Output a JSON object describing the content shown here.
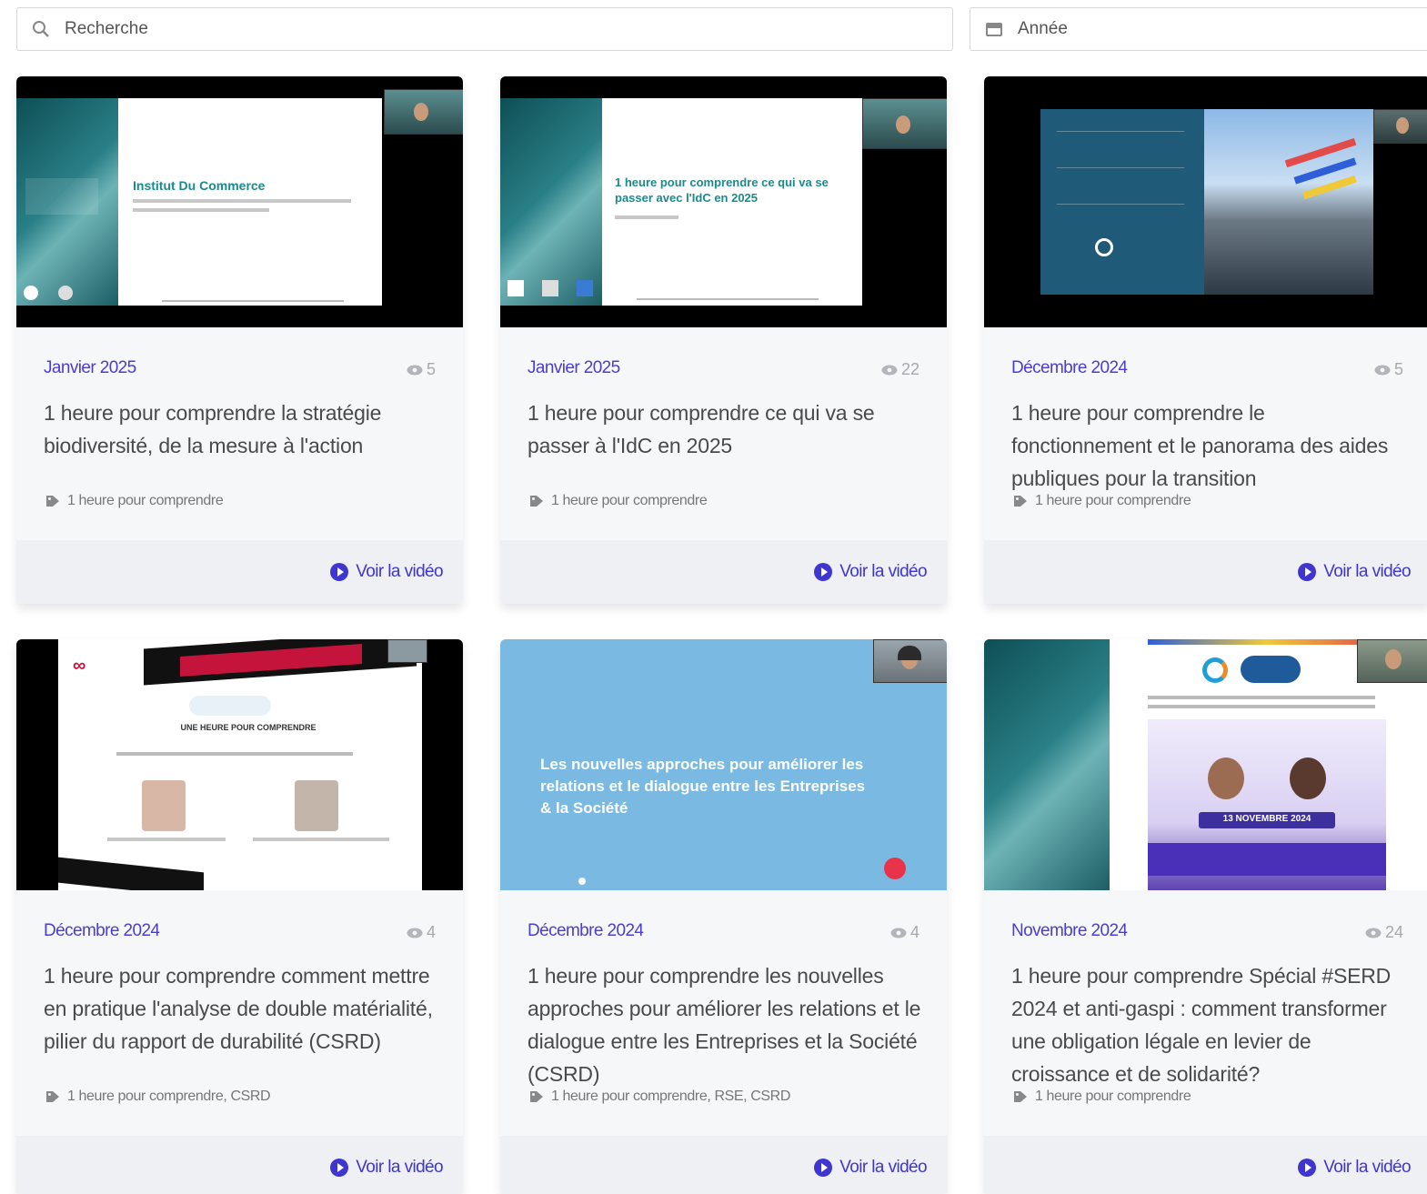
{
  "filters": {
    "search_placeholder": "Recherche",
    "year_placeholder": "Année"
  },
  "colors": {
    "accent": "#3f36d0",
    "card_bg": "#f6f7f9",
    "footer_bg": "#eef0f3"
  },
  "watch_label": "Voir la vidéo",
  "cards": [
    {
      "date": "Janvier 2025",
      "views": "5",
      "title": "1 heure pour comprendre la stratégie biodiversité, de la mesure à l'action",
      "tags": "1 heure pour comprendre",
      "slide": {
        "heading": "Institut Du Commerce"
      }
    },
    {
      "date": "Janvier 2025",
      "views": "22",
      "title": "1 heure pour comprendre ce qui va se passer à l'IdC en 2025",
      "tags": "1 heure pour comprendre",
      "slide": {
        "heading": "1 heure pour comprendre ce qui va se passer avec l'IdC en 2025"
      }
    },
    {
      "date": "Décembre 2024",
      "views": "5",
      "title": "1 heure pour comprendre le fonctionnement et le panorama des aides publiques pour la transition",
      "tags": "1 heure pour comprendre",
      "slide": {
        "heading": ""
      }
    },
    {
      "date": "Décembre 2024",
      "views": "4",
      "title": "1 heure pour comprendre comment mettre en pratique l'analyse de double matérialité, pilier du rapport de durabilité (CSRD)",
      "tags": "1 heure pour comprendre, CSRD",
      "slide": {
        "heading": "UNE HEURE POUR COMPRENDRE"
      }
    },
    {
      "date": "Décembre 2024",
      "views": "4",
      "title": "1 heure pour comprendre les nouvelles approches pour améliorer les relations et le dialogue entre les Entreprises et la Société (CSRD)",
      "tags": "1 heure pour comprendre, RSE, CSRD",
      "slide": {
        "heading": "Les nouvelles approches pour améliorer les relations et le dialogue entre les Entreprises & la Société"
      }
    },
    {
      "date": "Novembre 2024",
      "views": "24",
      "title": "1 heure pour comprendre Spécial #SERD 2024 et anti-gaspi : comment transformer une obligation légale en levier de croissance et de solidarité?",
      "tags": "1 heure pour comprendre",
      "slide": {
        "heading": "13 NOVEMBRE 2024"
      }
    }
  ]
}
